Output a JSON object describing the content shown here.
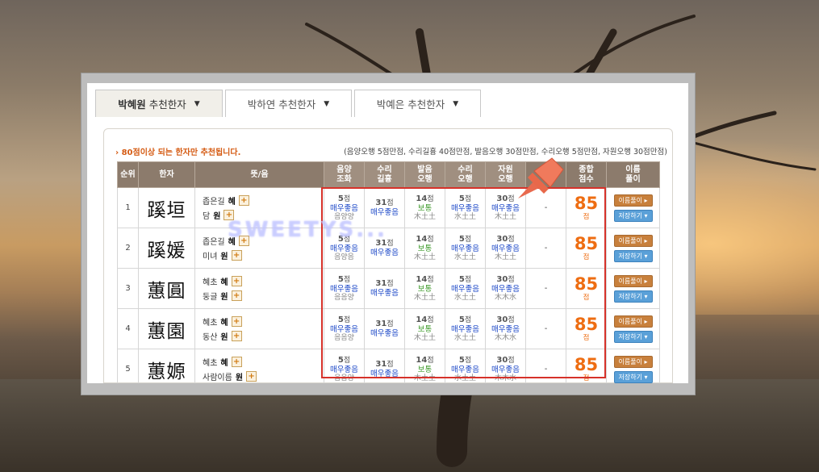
{
  "tabs": [
    {
      "name_bold": "박혜원",
      "name_rest": " 추천한자",
      "caret": "▼"
    },
    {
      "name_bold": "",
      "name_rest": "박하연 추천한자",
      "caret": "▼"
    },
    {
      "name_bold": "",
      "name_rest": "박예은 추천한자",
      "caret": "▼"
    }
  ],
  "notice": "› 80점이상 되는 한자만 추천됩니다.",
  "score_legend": "(음양오행 5점만점, 수리길흉 40점만점, 발음오행 30점만점, 수리오행 5점만점, 자원오행 30점만점)",
  "headers": {
    "rank": "순위",
    "hanja": "한자",
    "meaning": "뜻/음",
    "yinyang": [
      "음양",
      "조화"
    ],
    "suri": [
      "수리",
      "길흉"
    ],
    "sound": [
      "발음",
      "오행"
    ],
    "surielem": [
      "수리",
      "오행"
    ],
    "source": [
      "자원",
      "오행"
    ],
    "stroke": "획",
    "total": [
      "종합",
      "점수"
    ],
    "nameinterp": [
      "이름",
      "풀이"
    ]
  },
  "rows": [
    {
      "rank": "1",
      "hanja": "蹊垣",
      "m1": "좁은길",
      "s1": "혜",
      "m2": "담",
      "s2": "원",
      "c1": {
        "pts": "5",
        "rate": "매우좋음",
        "sub": "음양양"
      },
      "c2": {
        "pts": "31",
        "rate": "매우좋음",
        "sub": ""
      },
      "c3": {
        "pts": "14",
        "rate": "보통",
        "sub": "木土土"
      },
      "c4": {
        "pts": "5",
        "rate": "매우좋음",
        "sub": "水土土"
      },
      "c5": {
        "pts": "30",
        "rate": "매우좋음",
        "sub": "木土土"
      },
      "stroke": "-",
      "total": "85"
    },
    {
      "rank": "2",
      "hanja": "蹊媛",
      "m1": "좁은길",
      "s1": "혜",
      "m2": "미녀",
      "s2": "원",
      "c1": {
        "pts": "5",
        "rate": "매우좋음",
        "sub": "음양음"
      },
      "c2": {
        "pts": "31",
        "rate": "매우좋음",
        "sub": ""
      },
      "c3": {
        "pts": "14",
        "rate": "보통",
        "sub": "木土土"
      },
      "c4": {
        "pts": "5",
        "rate": "매우좋음",
        "sub": "水土土"
      },
      "c5": {
        "pts": "30",
        "rate": "매우좋음",
        "sub": "木土土"
      },
      "stroke": "-",
      "total": "85"
    },
    {
      "rank": "3",
      "hanja": "蕙圓",
      "m1": "혜초",
      "s1": "혜",
      "m2": "둥글",
      "s2": "원",
      "c1": {
        "pts": "5",
        "rate": "매우좋음",
        "sub": "음음양"
      },
      "c2": {
        "pts": "31",
        "rate": "매우좋음",
        "sub": ""
      },
      "c3": {
        "pts": "14",
        "rate": "보통",
        "sub": "木土土"
      },
      "c4": {
        "pts": "5",
        "rate": "매우좋음",
        "sub": "水土土"
      },
      "c5": {
        "pts": "30",
        "rate": "매우좋음",
        "sub": "木木水"
      },
      "stroke": "-",
      "total": "85"
    },
    {
      "rank": "4",
      "hanja": "蕙園",
      "m1": "혜초",
      "s1": "혜",
      "m2": "동산",
      "s2": "원",
      "c1": {
        "pts": "5",
        "rate": "매우좋음",
        "sub": "음음양"
      },
      "c2": {
        "pts": "31",
        "rate": "매우좋음",
        "sub": ""
      },
      "c3": {
        "pts": "14",
        "rate": "보통",
        "sub": "木土土"
      },
      "c4": {
        "pts": "5",
        "rate": "매우좋음",
        "sub": "水土土"
      },
      "c5": {
        "pts": "30",
        "rate": "매우좋음",
        "sub": "木木水"
      },
      "stroke": "-",
      "total": "85"
    },
    {
      "rank": "5",
      "hanja": "蕙嫄",
      "m1": "혜초",
      "s1": "혜",
      "m2": "사람이름",
      "s2": "원",
      "c1": {
        "pts": "5",
        "rate": "매우좋음",
        "sub": "음음양"
      },
      "c2": {
        "pts": "31",
        "rate": "매우좋음",
        "sub": ""
      },
      "c3": {
        "pts": "14",
        "rate": "보통",
        "sub": "木土土"
      },
      "c4": {
        "pts": "5",
        "rate": "매우좋음",
        "sub": "水土土"
      },
      "c5": {
        "pts": "30",
        "rate": "매우좋음",
        "sub": "木木水"
      },
      "stroke": "-",
      "total": "85"
    }
  ],
  "labels": {
    "pts_unit": "점",
    "total_unit": "점",
    "interp_button": "이름풀이 ▸",
    "save_button": "저장하기 ▾",
    "plus": "+"
  },
  "watermark": "SWEETYS...",
  "colors": {
    "accent_orange": "#ee6d12",
    "good_blue": "#1a46c7",
    "normal_green": "#3d9a2a",
    "header_brown": "#8c7b6c",
    "highlight_red": "#d6322a"
  },
  "icons": {
    "tab_caret": "caret-down-icon",
    "plus": "plus-icon",
    "pin": "pushpin-icon"
  }
}
